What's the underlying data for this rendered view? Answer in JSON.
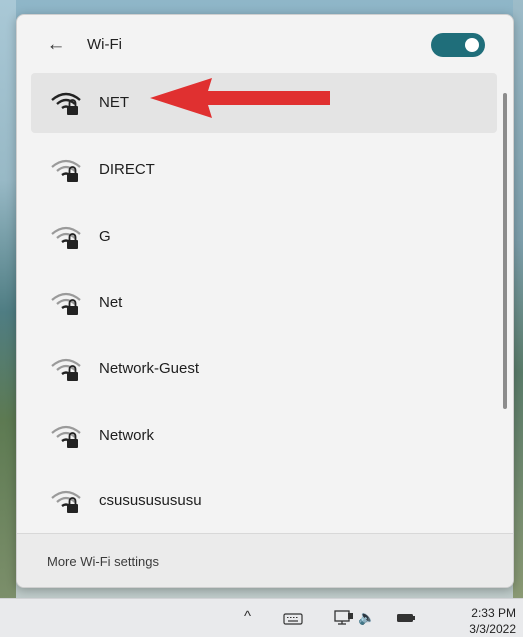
{
  "header": {
    "back_icon": "back-arrow-icon",
    "title": "Wi-Fi",
    "toggle_on": true,
    "toggle_color": "#1f6e7a"
  },
  "networks": [
    {
      "name": "NET",
      "selected": true,
      "secured": true
    },
    {
      "name": "DIRECT",
      "selected": false,
      "secured": true
    },
    {
      "name": "G",
      "selected": false,
      "secured": true
    },
    {
      "name": "Net",
      "selected": false,
      "secured": true
    },
    {
      "name": "Network-Guest",
      "selected": false,
      "secured": true
    },
    {
      "name": "Network",
      "selected": false,
      "secured": true
    },
    {
      "name": "csusususususu",
      "selected": false,
      "secured": true
    }
  ],
  "footer": {
    "more_settings": "More Wi-Fi settings"
  },
  "annotation": {
    "arrow_color": "#e03030",
    "points_to": "NET"
  },
  "taskbar": {
    "chevron_icon": "chevron-up-icon",
    "keyboard_icon": "keyboard-icon",
    "network_icon": "network-icon",
    "volume_icon": "volume-icon",
    "battery_icon": "battery-icon",
    "time": "2:33 PM",
    "date": "3/3/2022"
  }
}
